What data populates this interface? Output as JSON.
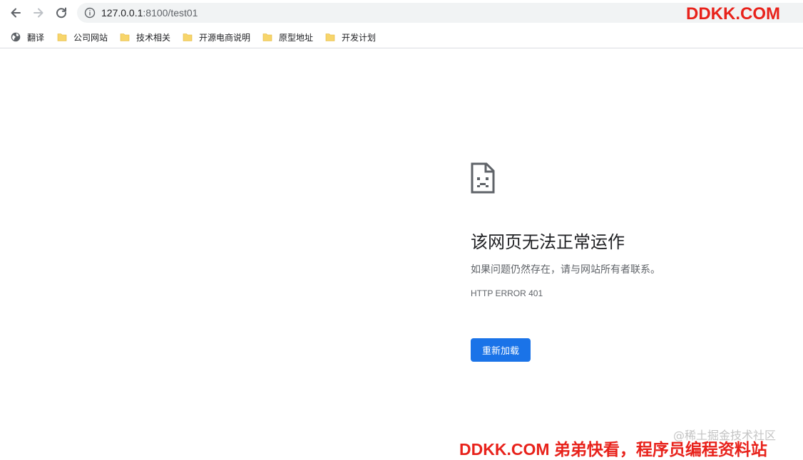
{
  "browser": {
    "address_bar": {
      "host": "127.0.0.1",
      "path": ":8100/test01"
    },
    "bookmarks": [
      {
        "label": "翻译",
        "icon": "globe-icon"
      },
      {
        "label": "公司网站",
        "icon": "folder-icon"
      },
      {
        "label": "技术相关",
        "icon": "folder-icon"
      },
      {
        "label": "开源电商说明",
        "icon": "folder-icon"
      },
      {
        "label": "原型地址",
        "icon": "folder-icon"
      },
      {
        "label": "开发计划",
        "icon": "folder-icon"
      }
    ]
  },
  "error_page": {
    "title": "该网页无法正常运作",
    "description": "如果问题仍然存在，请与网站所有者联系。",
    "error_code": "HTTP ERROR 401",
    "reload_label": "重新加载"
  },
  "watermarks": {
    "top": "DDKK.COM",
    "juejin": "@稀土掘金技术社区",
    "bottom": "DDKK.COM 弟弟快看，程序员编程资料站"
  },
  "colors": {
    "accent": "#1a73e8",
    "watermark_red": "#e8221b",
    "folder_yellow": "#f7d56b"
  }
}
